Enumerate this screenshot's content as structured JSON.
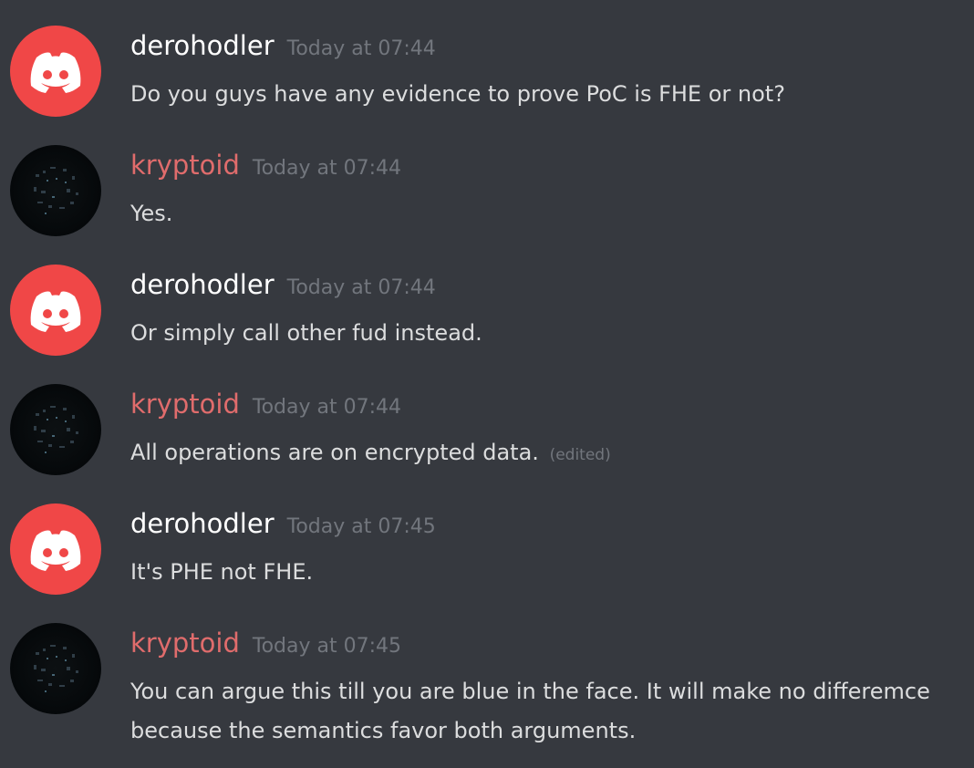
{
  "messages": [
    {
      "author": "derohodler",
      "timestamp": "Today at 07:44",
      "text": "Do you guys have any evidence to prove PoC is FHE or not?",
      "edited": ""
    },
    {
      "author": "kryptoid",
      "timestamp": "Today at 07:44",
      "text": "Yes.",
      "edited": ""
    },
    {
      "author": "derohodler",
      "timestamp": "Today at 07:44",
      "text": "Or simply call other fud instead.",
      "edited": ""
    },
    {
      "author": "kryptoid",
      "timestamp": "Today at 07:44",
      "text": "All operations are on encrypted data.",
      "edited": "(edited)"
    },
    {
      "author": "derohodler",
      "timestamp": "Today at 07:45",
      "text": "It's PHE not FHE.",
      "edited": ""
    },
    {
      "author": "kryptoid",
      "timestamp": "Today at 07:45",
      "text": "You can argue this till you are blue in the face. It will make no differemce because the semantics favor both arguments.",
      "edited": ""
    }
  ],
  "colors": {
    "background": "#36393f",
    "discord_avatar": "#f04747",
    "kryptoid_name": "#e06c6c",
    "timestamp": "#72767d"
  },
  "icons": {
    "derohodler_avatar": "discord-logo-icon",
    "kryptoid_avatar": "dark-pixel-avatar-icon"
  }
}
